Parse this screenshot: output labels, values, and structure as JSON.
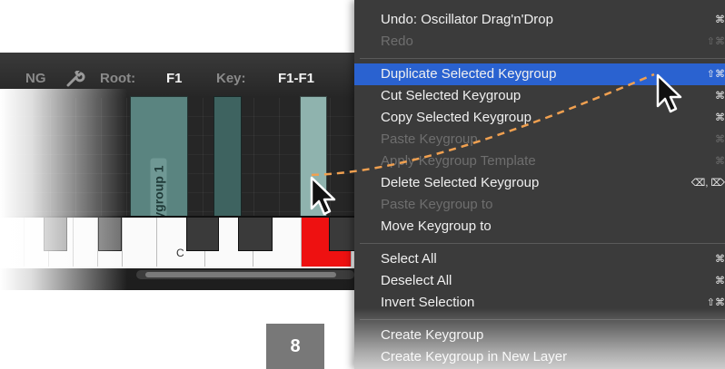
{
  "toolbar": {
    "prefix_fragment": "NG",
    "root_label": "Root:",
    "root_value": "F1",
    "key_label": "Key:",
    "key_value": "F1-F1"
  },
  "keygroups": [
    {
      "label": "Keygroup 1"
    }
  ],
  "keyboard": {
    "c_label": "C"
  },
  "menu": {
    "items": [
      {
        "label": "Undo:  Oscillator Drag'n'Drop",
        "shortcut": "⌘",
        "enabled": true
      },
      {
        "label": "Redo",
        "shortcut": "⇧⌘",
        "enabled": false
      },
      {
        "label": "Duplicate Selected Keygroup",
        "shortcut": "⇧⌘",
        "enabled": true,
        "highlighted": true
      },
      {
        "label": "Cut Selected Keygroup",
        "shortcut": "⌘",
        "enabled": true
      },
      {
        "label": "Copy Selected Keygroup",
        "shortcut": "⌘",
        "enabled": true
      },
      {
        "label": "Paste Keygroup",
        "shortcut": "⌘",
        "enabled": false
      },
      {
        "label": "Apply Keygroup Template",
        "shortcut": "⌘",
        "enabled": false
      },
      {
        "label": "Delete Selected Keygroup",
        "shortcut": "⌫, ⌦",
        "enabled": true
      },
      {
        "label": "Paste Keygroup to",
        "shortcut": "",
        "enabled": false
      },
      {
        "label": "Move Keygroup to",
        "shortcut": "",
        "enabled": true
      },
      {
        "label": "Select All",
        "shortcut": "⌘",
        "enabled": true
      },
      {
        "label": "Deselect All",
        "shortcut": "⌘",
        "enabled": true
      },
      {
        "label": "Invert Selection",
        "shortcut": "⇧⌘",
        "enabled": true
      },
      {
        "label": "Create Keygroup",
        "shortcut": "",
        "enabled": true
      },
      {
        "label": "Create Keygroup in New Layer",
        "shortcut": "",
        "enabled": true
      }
    ]
  },
  "step_badge": "8",
  "colors": {
    "menu_background": "#3b3b3b",
    "menu_highlight": "#2a62d0",
    "keygroup_teal": "#5a8480",
    "drag_path": "#f0a050",
    "active_key": "#ee1111"
  }
}
